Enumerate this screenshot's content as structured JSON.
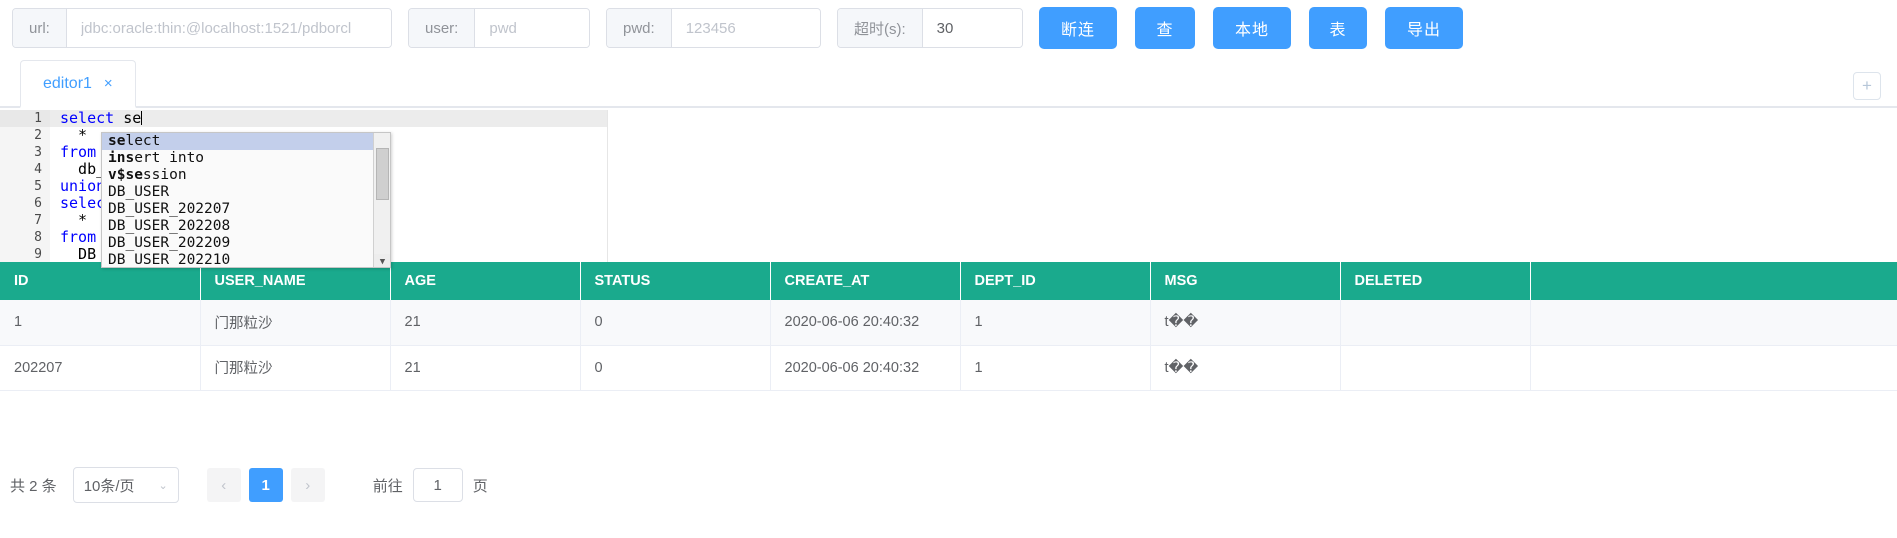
{
  "toolbar": {
    "url": {
      "label": "url:",
      "placeholder": "jdbc:oracle:thin:@localhost:1521/pdborcl",
      "value": ""
    },
    "user": {
      "label": "user:",
      "placeholder": "pwd",
      "value": ""
    },
    "pwd": {
      "label": "pwd:",
      "placeholder": "123456",
      "value": ""
    },
    "timeout": {
      "label": "超时(s):",
      "placeholder": "",
      "value": "30"
    },
    "buttons": [
      {
        "name": "disconnect",
        "label": "断连"
      },
      {
        "name": "query",
        "label": "查"
      },
      {
        "name": "local",
        "label": "本地"
      },
      {
        "name": "table",
        "label": "表"
      },
      {
        "name": "export",
        "label": "导出"
      }
    ],
    "accent_color": "#409eff"
  },
  "tabs": {
    "items": [
      {
        "label": "editor1",
        "close": "×",
        "active": true
      }
    ],
    "add_label": "+"
  },
  "editor": {
    "lines": [
      {
        "no": "1",
        "segments": [
          {
            "t": "select ",
            "c": "kw"
          },
          {
            "t": "se",
            "c": "plain"
          }
        ],
        "caret": true
      },
      {
        "no": "2",
        "segments": [
          {
            "t": "  *",
            "c": "plain"
          }
        ]
      },
      {
        "no": "3",
        "segments": [
          {
            "t": "from",
            "c": "kw"
          }
        ]
      },
      {
        "no": "4",
        "segments": [
          {
            "t": "  db_u",
            "c": "plain"
          }
        ]
      },
      {
        "no": "5",
        "segments": [
          {
            "t": "union ",
            "c": "kw"
          },
          {
            "t": ".",
            "c": "plain"
          }
        ]
      },
      {
        "no": "6",
        "segments": [
          {
            "t": "select",
            "c": "kw"
          }
        ]
      },
      {
        "no": "7",
        "segments": [
          {
            "t": "  *",
            "c": "plain"
          }
        ]
      },
      {
        "no": "8",
        "segments": [
          {
            "t": "from",
            "c": "kw"
          }
        ]
      },
      {
        "no": "9",
        "segments": [
          {
            "t": "  DB_U",
            "c": "plain"
          }
        ]
      }
    ]
  },
  "autocomplete": {
    "items": [
      {
        "match": "se",
        "rest": "lect",
        "selected": true
      },
      {
        "match": "ins",
        "rest": "ert into",
        "selected": false
      },
      {
        "match": "v$se",
        "rest": "ssion",
        "selected": false
      },
      {
        "match": "",
        "rest": "DB_USER",
        "selected": false
      },
      {
        "match": "",
        "rest": "DB_USER_202207",
        "selected": false
      },
      {
        "match": "",
        "rest": "DB_USER_202208",
        "selected": false
      },
      {
        "match": "",
        "rest": "DB_USER_202209",
        "selected": false
      },
      {
        "match": "",
        "rest": "DB_USER_202210",
        "selected": false
      }
    ],
    "scroll_down_glyph": "▼"
  },
  "table": {
    "header_color": "#1aaa8d",
    "columns": [
      "ID",
      "USER_NAME",
      "AGE",
      "STATUS",
      "CREATE_AT",
      "DEPT_ID",
      "MSG",
      "DELETED",
      ""
    ],
    "rows": [
      {
        "ID": "1",
        "USER_NAME": "门那粒沙",
        "AGE": "21",
        "STATUS": "0",
        "CREATE_AT": "2020-06-06 20:40:32",
        "DEPT_ID": "1",
        "MSG": "t��",
        "DELETED": "",
        "EXTRA": ""
      },
      {
        "ID": "202207",
        "USER_NAME": "门那粒沙",
        "AGE": "21",
        "STATUS": "0",
        "CREATE_AT": "2020-06-06 20:40:32",
        "DEPT_ID": "1",
        "MSG": "t��",
        "DELETED": "",
        "EXTRA": ""
      }
    ]
  },
  "pagination": {
    "total_text": "共 2 条",
    "page_size_label": "10条/页",
    "chevron": "⌄",
    "prev_glyph": "‹",
    "next_glyph": "›",
    "current_page": "1",
    "jump_label": "前往",
    "jump_value": "1",
    "jump_suffix": "页"
  }
}
